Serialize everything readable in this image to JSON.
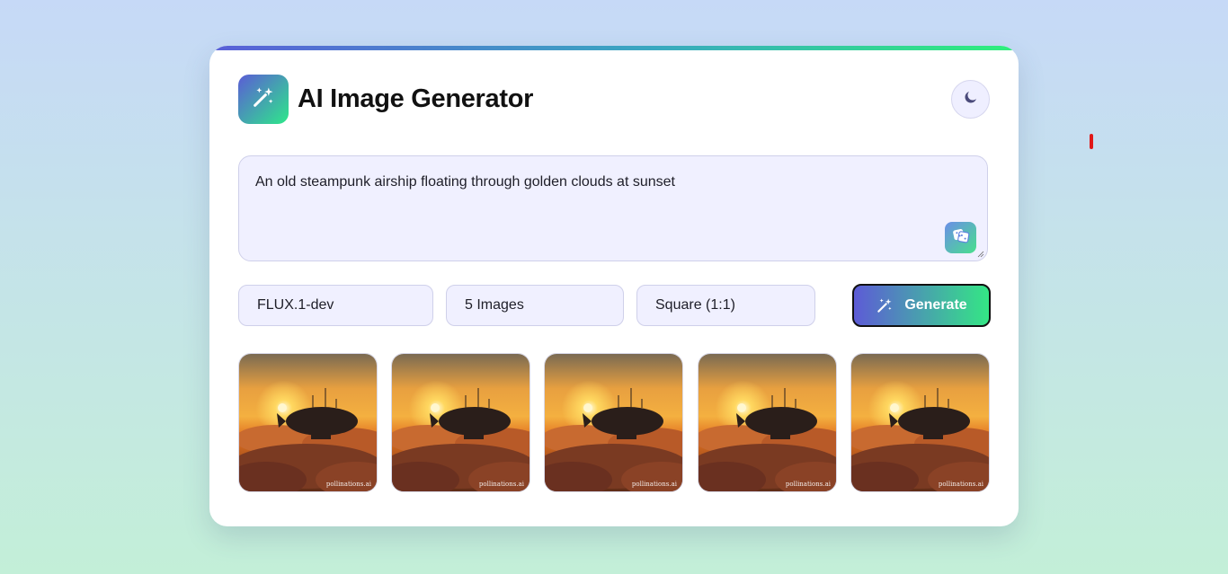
{
  "app": {
    "title": "AI Image Generator",
    "logo_icon": "magic-wand-icon",
    "theme_toggle_icon": "moon-icon"
  },
  "prompt": {
    "value": "An old steampunk airship floating through golden clouds at sunset",
    "random_button_icon": "dice-icon"
  },
  "controls": {
    "model": "FLUX.1-dev",
    "count": "5 Images",
    "aspect_ratio": "Square (1:1)",
    "generate_label": "Generate",
    "generate_icon": "magic-wand-icon"
  },
  "gallery": {
    "images": [
      {
        "watermark": "pollinations.ai"
      },
      {
        "watermark": "pollinations.ai"
      },
      {
        "watermark": "pollinations.ai"
      },
      {
        "watermark": "pollinations.ai"
      },
      {
        "watermark": "pollinations.ai"
      }
    ]
  },
  "colors": {
    "accent_start": "#5b5cd6",
    "accent_end": "#2ee88a",
    "field_bg": "#f0f0ff",
    "marker": "#e01818"
  }
}
